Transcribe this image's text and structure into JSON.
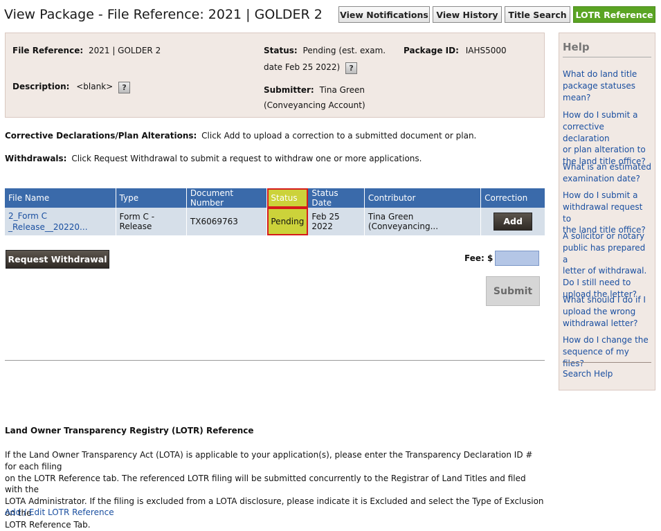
{
  "header": {
    "title": "View Package - File Reference: 2021 | GOLDER 2",
    "tabs": [
      {
        "label": "View Notifications"
      },
      {
        "label": "View History"
      },
      {
        "label": "Title Search"
      },
      {
        "label": "LOTR Reference",
        "active": true
      }
    ]
  },
  "info": {
    "file_ref_label": "File Reference:",
    "file_ref_value": "2021 | GOLDER 2",
    "status_label": "Status:",
    "status_value_1": "Pending (est. exam.",
    "status_value_2": "date Feb 25 2022)",
    "package_id_label": "Package ID:",
    "package_id_value": "IAHS5000",
    "description_label": "Description:",
    "description_value": "<blank>",
    "submitter_label": "Submitter:",
    "submitter_value_1": "Tina Green",
    "submitter_value_2": "(Conveyancing Account)",
    "help_glyph": "?"
  },
  "corrective": {
    "label": "Corrective Declarations/Plan Alterations:",
    "text": "Click Add to upload a correction to a submitted document or plan."
  },
  "withdrawals": {
    "label": "Withdrawals:",
    "text": "Click Request Withdrawal to submit a request to withdraw one or more applications."
  },
  "table": {
    "headers": [
      "File Name",
      "Type",
      "Document Number",
      "Status",
      "Status Date",
      "Contributor",
      "Correction"
    ],
    "rows": [
      {
        "file_name_1": "2_Form C",
        "file_name_2": "_Release__20220...",
        "type": "Form C - Release",
        "doc_number": "TX6069763",
        "status": "Pending",
        "status_date": "Feb 25 2022",
        "contributor": "Tina Green (Conveyancing...",
        "correction_label": "Add"
      }
    ]
  },
  "actions": {
    "request_withdrawal": "Request Withdrawal",
    "fee_label": "Fee: $",
    "fee_value": "",
    "submit": "Submit"
  },
  "lotr": {
    "title": "Land Owner Transparency Registry (LOTR) Reference",
    "para_1": "If the Land Owner Transparency Act (LOTA) is applicable to your application(s), please enter the Transparency Declaration ID # for each filing",
    "para_2": "on the LOTR Reference tab. The referenced LOTR filing will be submitted concurrently to the Registrar of Land Titles and filed with the",
    "para_3": "LOTA Administrator. If the filing is excluded from a LOTA disclosure, please indicate it is Excluded and select the Type of Exclusion on the",
    "para_4": "LOTR Reference Tab.",
    "link": "Add / Edit LOTR Reference"
  },
  "help": {
    "title": "Help",
    "links": [
      {
        "lines": [
          "What do land title",
          "package statuses",
          "mean?"
        ]
      },
      {
        "lines": [
          "How do I submit a",
          "corrective declaration",
          "or plan alteration to",
          "the land title office?"
        ]
      },
      {
        "lines": [
          "What is an estimated",
          "examination date?"
        ]
      },
      {
        "lines": [
          "How do I submit a",
          "withdrawal request to",
          "the land title office?"
        ]
      },
      {
        "lines": [
          "A solicitor or notary",
          "public has prepared a",
          "letter of withdrawal.",
          "Do I still need to",
          "upload the letter?"
        ]
      },
      {
        "lines": [
          "What should I do if I",
          "upload the wrong",
          "withdrawal letter?"
        ]
      },
      {
        "lines": [
          "How do I change the",
          "sequence of my files?"
        ]
      }
    ],
    "search": "Search Help"
  }
}
